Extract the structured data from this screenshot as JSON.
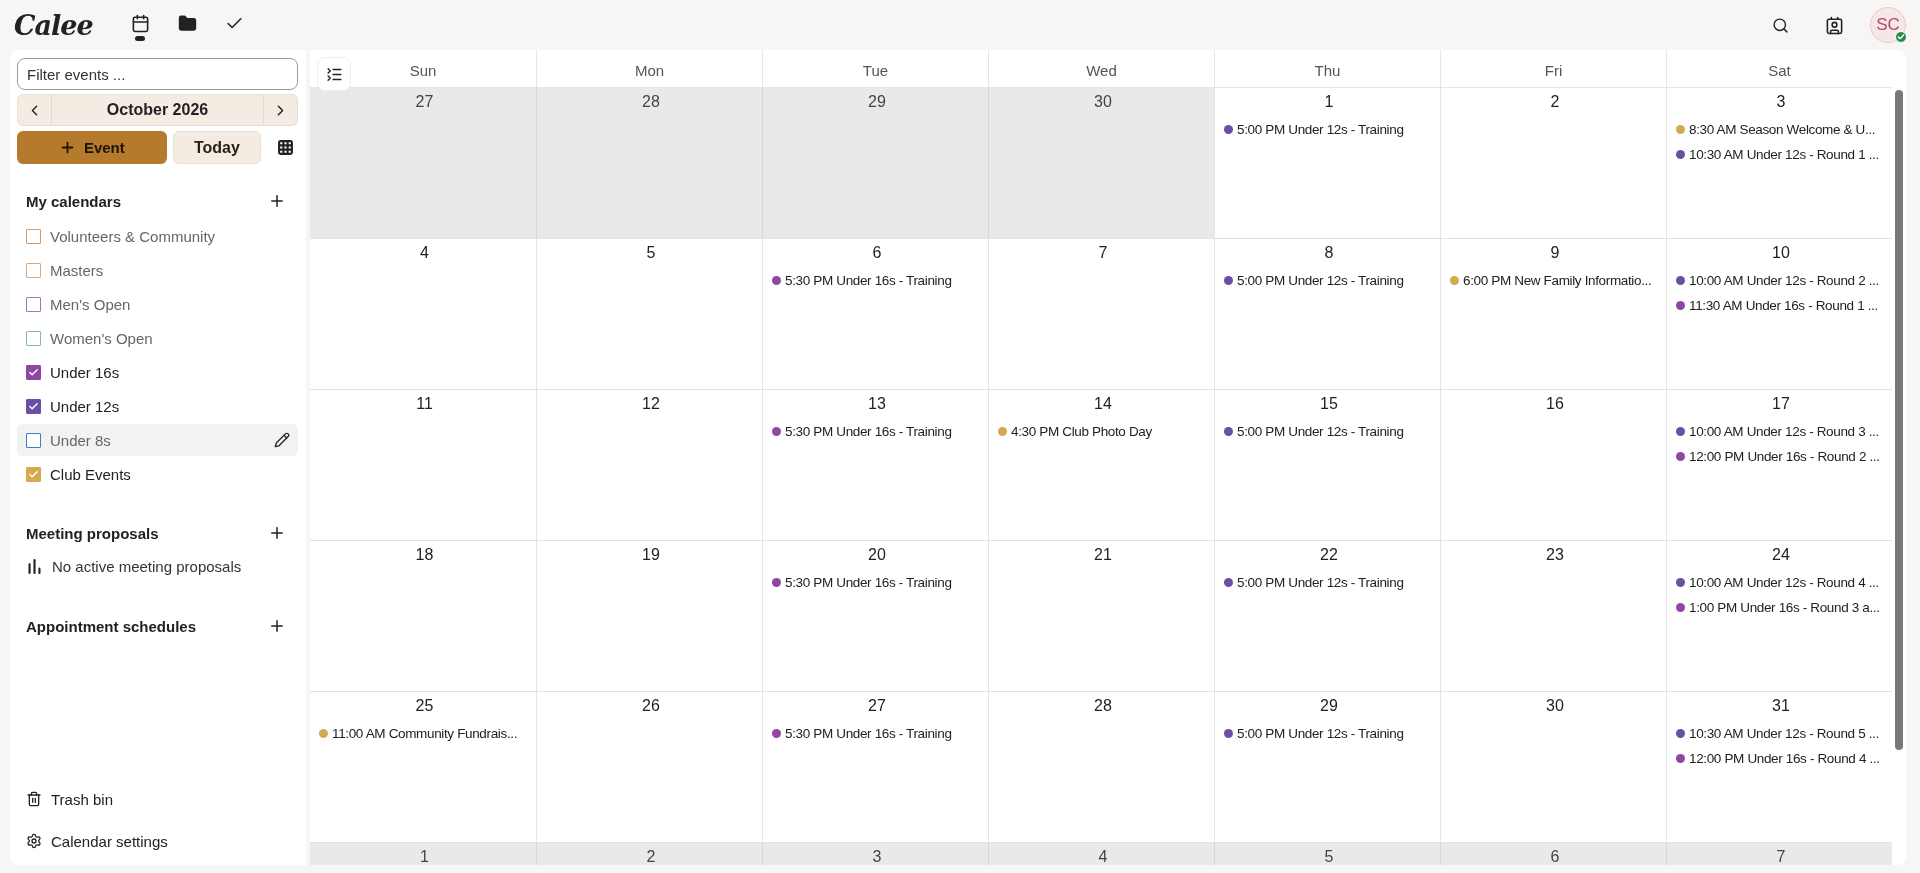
{
  "logo": "Calee",
  "app_nav": [
    {
      "selected": true
    },
    {
      "selected": false
    },
    {
      "selected": false
    }
  ],
  "user": {
    "initials": "SC",
    "online": true
  },
  "sidebar": {
    "filter": {
      "placeholder": "Filter events ..."
    },
    "month": "October 2026",
    "new_event": "Event",
    "today": "Today",
    "my_calendars": {
      "title": "My calendars",
      "items": [
        {
          "name": "Volunteers & Community",
          "color": "#d39a6c",
          "checked": false,
          "hovered": false
        },
        {
          "name": "Masters",
          "color": "#d8ab86",
          "checked": false,
          "hovered": false
        },
        {
          "name": "Men's Open",
          "color": "#a872b8",
          "checked": false,
          "hovered": false
        },
        {
          "name": "Women's Open",
          "color": "#86b8a6",
          "checked": false,
          "hovered": false
        },
        {
          "name": "Under 16s",
          "color": "#8f47a3",
          "checked": true,
          "hovered": false
        },
        {
          "name": "Under 12s",
          "color": "#6b4ea6",
          "checked": true,
          "hovered": false
        },
        {
          "name": "Under 8s",
          "color": "#3d7bc4",
          "checked": false,
          "hovered": true
        },
        {
          "name": "Club Events",
          "color": "#d4aa50",
          "checked": true,
          "hovered": false
        }
      ]
    },
    "meeting_proposals": {
      "title": "Meeting proposals",
      "empty": "No active meeting proposals"
    },
    "appointment_schedules": {
      "title": "Appointment schedules"
    },
    "footer": [
      "Trash bin",
      "Calendar settings"
    ]
  },
  "calendar": {
    "weekdays": [
      "Sun",
      "Mon",
      "Tue",
      "Wed",
      "Thu",
      "Fri",
      "Sat"
    ],
    "weeks": [
      [
        {
          "date": "27",
          "outside": true
        },
        {
          "date": "28",
          "outside": true
        },
        {
          "date": "29",
          "outside": true
        },
        {
          "date": "30",
          "outside": true
        },
        {
          "date": "1",
          "outside": false,
          "events": [
            {
              "text": "5:00 PM Under 12s - Training",
              "color": "#6b4ea6"
            }
          ]
        },
        {
          "date": "2",
          "outside": false
        },
        {
          "date": "3",
          "outside": false,
          "events": [
            {
              "text": "8:30 AM Season Welcome & U...",
              "color": "#d4aa50"
            },
            {
              "text": "10:30 AM Under 12s - Round 1 ...",
              "color": "#6b4ea6"
            }
          ]
        }
      ],
      [
        {
          "date": "4",
          "outside": false
        },
        {
          "date": "5",
          "outside": false
        },
        {
          "date": "6",
          "outside": false,
          "events": [
            {
              "text": "5:30 PM Under 16s - Training",
              "color": "#8f47a3"
            }
          ]
        },
        {
          "date": "7",
          "outside": false
        },
        {
          "date": "8",
          "outside": false,
          "events": [
            {
              "text": "5:00 PM Under 12s - Training",
              "color": "#6b4ea6"
            }
          ]
        },
        {
          "date": "9",
          "outside": false,
          "events": [
            {
              "text": "6:00 PM New Family Informatio...",
              "color": "#d4aa50"
            }
          ]
        },
        {
          "date": "10",
          "outside": false,
          "events": [
            {
              "text": "10:00 AM Under 12s - Round 2 ...",
              "color": "#6b4ea6"
            },
            {
              "text": "11:30 AM Under 16s - Round 1 ...",
              "color": "#8f47a3"
            }
          ]
        }
      ],
      [
        {
          "date": "11",
          "outside": false
        },
        {
          "date": "12",
          "outside": false
        },
        {
          "date": "13",
          "outside": false,
          "events": [
            {
              "text": "5:30 PM Under 16s - Training",
              "color": "#8f47a3"
            }
          ]
        },
        {
          "date": "14",
          "outside": false,
          "events": [
            {
              "text": "4:30 PM Club Photo Day",
              "color": "#d4aa50"
            }
          ]
        },
        {
          "date": "15",
          "outside": false,
          "events": [
            {
              "text": "5:00 PM Under 12s - Training",
              "color": "#6b4ea6"
            }
          ]
        },
        {
          "date": "16",
          "outside": false
        },
        {
          "date": "17",
          "outside": false,
          "events": [
            {
              "text": "10:00 AM Under 12s - Round 3 ...",
              "color": "#6b4ea6"
            },
            {
              "text": "12:00 PM Under 16s - Round 2 ...",
              "color": "#8f47a3"
            }
          ]
        }
      ],
      [
        {
          "date": "18",
          "outside": false
        },
        {
          "date": "19",
          "outside": false
        },
        {
          "date": "20",
          "outside": false,
          "events": [
            {
              "text": "5:30 PM Under 16s - Training",
              "color": "#8f47a3"
            }
          ]
        },
        {
          "date": "21",
          "outside": false
        },
        {
          "date": "22",
          "outside": false,
          "events": [
            {
              "text": "5:00 PM Under 12s - Training",
              "color": "#6b4ea6"
            }
          ]
        },
        {
          "date": "23",
          "outside": false
        },
        {
          "date": "24",
          "outside": false,
          "events": [
            {
              "text": "10:00 AM Under 12s - Round 4 ...",
              "color": "#6b4ea6"
            },
            {
              "text": "1:00 PM Under 16s - Round 3 a...",
              "color": "#8f47a3"
            }
          ]
        }
      ],
      [
        {
          "date": "25",
          "outside": false,
          "events": [
            {
              "text": "11:00 AM Community Fundrais...",
              "color": "#d4aa50"
            }
          ]
        },
        {
          "date": "26",
          "outside": false
        },
        {
          "date": "27",
          "outside": false,
          "events": [
            {
              "text": "5:30 PM Under 16s - Training",
              "color": "#8f47a3"
            }
          ]
        },
        {
          "date": "28",
          "outside": false
        },
        {
          "date": "29",
          "outside": false,
          "events": [
            {
              "text": "5:00 PM Under 12s - Training",
              "color": "#6b4ea6"
            }
          ]
        },
        {
          "date": "30",
          "outside": false
        },
        {
          "date": "31",
          "outside": false,
          "events": [
            {
              "text": "10:30 AM Under 12s - Round 5 ...",
              "color": "#6b4ea6"
            },
            {
              "text": "12:00 PM Under 16s - Round 4 ...",
              "color": "#8f47a3"
            }
          ]
        }
      ],
      [
        {
          "date": "1",
          "outside": true
        },
        {
          "date": "2",
          "outside": true
        },
        {
          "date": "3",
          "outside": true
        },
        {
          "date": "4",
          "outside": true
        },
        {
          "date": "5",
          "outside": true
        },
        {
          "date": "6",
          "outside": true
        },
        {
          "date": "7",
          "outside": true
        }
      ]
    ]
  }
}
